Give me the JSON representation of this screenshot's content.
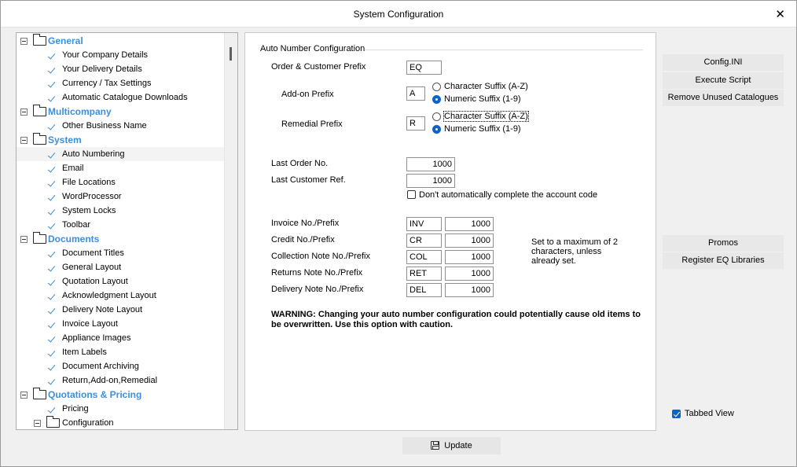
{
  "window": {
    "title": "System Configuration",
    "close_glyph": "✕"
  },
  "tree": {
    "categories": [
      {
        "label": "General",
        "items": [
          "Your Company Details",
          "Your Delivery Details",
          "Currency / Tax Settings",
          "Automatic Catalogue Downloads"
        ]
      },
      {
        "label": "Multicompany",
        "items": [
          "Other Business Name"
        ]
      },
      {
        "label": "System",
        "items": [
          "Auto Numbering",
          "Email",
          "File Locations",
          "WordProcessor",
          "System Locks",
          "Toolbar"
        ]
      },
      {
        "label": "Documents",
        "items": [
          "Document Titles",
          "General Layout",
          "Quotation Layout",
          "Acknowledgment Layout",
          "Delivery Note Layout",
          "Invoice Layout",
          "Appliance Images",
          "Item Labels",
          "Document Archiving",
          "Return,Add-on,Remedial"
        ]
      },
      {
        "label": "Quotations & Pricing",
        "items": [
          "Pricing"
        ]
      }
    ],
    "sub_folder": "Configuration",
    "selected_item": "Auto Numbering"
  },
  "auto_number": {
    "group_title": "Auto Number Configuration",
    "order_customer_prefix_label": "Order & Customer Prefix",
    "order_customer_prefix_value": "EQ",
    "addon_prefix_label": "Add-on Prefix",
    "addon_prefix_value": "A",
    "addon_char_suffix": "Character Suffix (A-Z)",
    "addon_num_suffix": "Numeric Suffix (1-9)",
    "remedial_prefix_label": "Remedial Prefix",
    "remedial_prefix_value": "R",
    "remedial_char_suffix": "Character Suffix (A-Z)",
    "remedial_num_suffix": "Numeric Suffix (1-9)",
    "last_order_label": "Last Order No.",
    "last_order_value": "1000",
    "last_customer_label": "Last Customer Ref.",
    "last_customer_value": "1000",
    "dont_complete_label": "Don't automatically complete the account code",
    "docs": [
      {
        "label": "Invoice No./Prefix",
        "prefix": "INV",
        "number": "1000"
      },
      {
        "label": "Credit No./Prefix",
        "prefix": "CR",
        "number": "1000"
      },
      {
        "label": "Collection Note No./Prefix",
        "prefix": "COL",
        "number": "1000"
      },
      {
        "label": "Returns Note No./Prefix",
        "prefix": "RET",
        "number": "1000"
      },
      {
        "label": "Delivery Note No./Prefix",
        "prefix": "DEL",
        "number": "1000"
      }
    ],
    "note": "Set to a maximum of 2 characters, unless already set.",
    "warning": "WARNING: Changing your auto number configuration could potentially cause old items to be overwritten. Use this option with caution."
  },
  "side_buttons": {
    "config_ini": "Config.INI",
    "execute_script": "Execute Script",
    "remove_unused": "Remove Unused Catalogues",
    "promos": "Promos",
    "register_eq": "Register EQ Libraries"
  },
  "tabbed_view_label": "Tabbed View",
  "update_label": "Update",
  "colors": {
    "category": "#3d8fdc",
    "check": "#2d8fdd",
    "accent": "#0a64c8"
  }
}
